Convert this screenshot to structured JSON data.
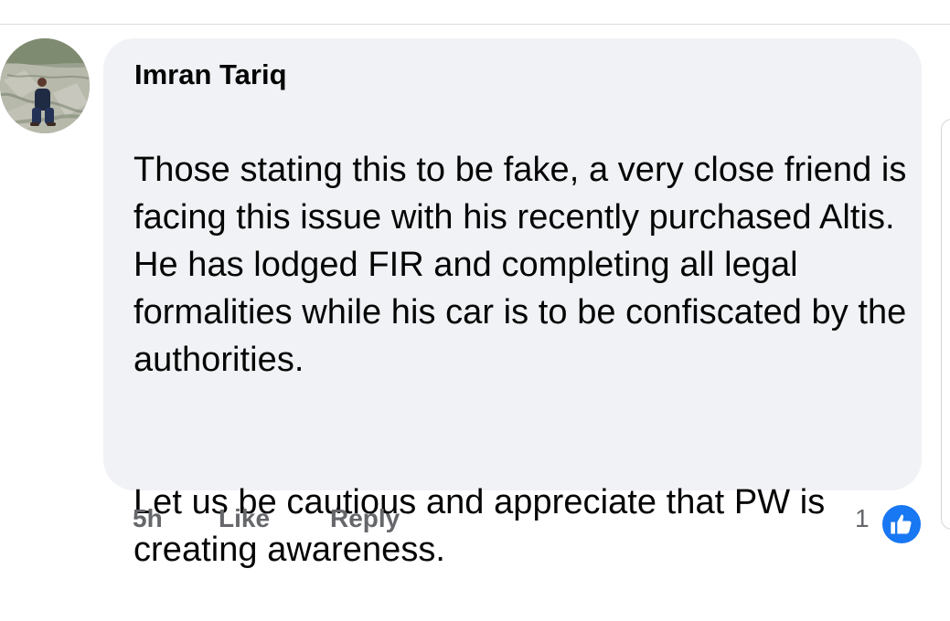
{
  "comment": {
    "author": "Imran Tariq",
    "paragraphs": [
      "Those stating this to be fake, a very close friend is facing this issue with his recently purchased Altis. He has lodged FIR and completing all legal formalities while his car is to be confiscated by the authorities.",
      "Let us be cautious and appreciate that PW is creating awareness."
    ],
    "timestamp": "5h",
    "like_label": "Like",
    "reply_label": "Reply",
    "reaction_count": "1",
    "reaction_icon": "thumbs-up-icon"
  },
  "colors": {
    "bubble_background": "#f0f2f5",
    "secondary_text": "#65676b",
    "reaction_blue": "#1877f2"
  }
}
